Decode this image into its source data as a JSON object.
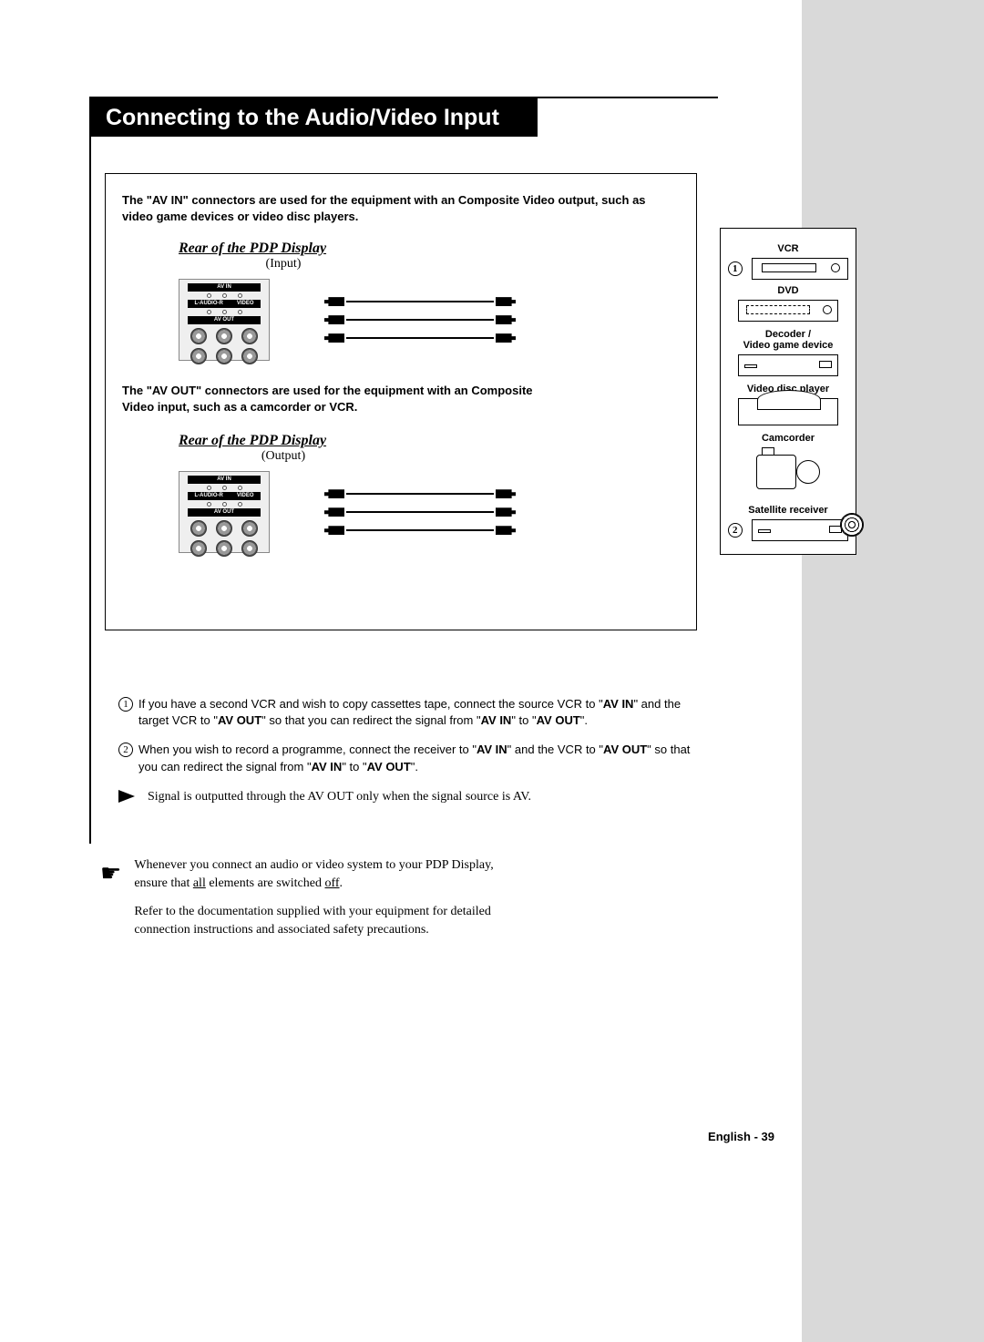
{
  "title": "Connecting to the Audio/Video Input",
  "intro": "The \"AV IN\" connectors are used for the equipment with an Composite Video output, such as video game devices or video disc players.",
  "section1": {
    "heading": "Rear of the PDP Display",
    "sub": "(Input)"
  },
  "mid": "The \"AV OUT\" connectors are used for the equipment with an Composite Video input, such as a camcorder or VCR.",
  "section2": {
    "heading": "Rear of the PDP Display",
    "sub": "(Output)"
  },
  "panel": {
    "av_in": "AV IN",
    "audio_l": "L-AUDIO-R",
    "video": "VIDEO",
    "av_out": "AV OUT"
  },
  "devices": {
    "num1": "1",
    "vcr": "VCR",
    "dvd": "DVD",
    "decoder": "Decoder /",
    "game": "Video game device",
    "disc": "Video disc player",
    "cam": "Camcorder",
    "sat": "Satellite receiver",
    "num2": "2"
  },
  "notes": {
    "n1_num": "1",
    "n1_a": "If you have a second VCR and wish to copy cassettes tape, connect the source VCR to \"",
    "n1_b": "AV IN",
    "n1_c": "\" and the target VCR to \"",
    "n1_d": "AV OUT",
    "n1_e": "\" so that you can redirect the signal from \"",
    "n1_f": "AV IN",
    "n1_g": "\" to \"",
    "n1_h": "AV OUT",
    "n1_i": "\".",
    "n2_num": "2",
    "n2_a": "When you wish to record a programme, connect the receiver to \"",
    "n2_b": "AV IN",
    "n2_c": "\" and the VCR to \"",
    "n2_d": "AV OUT",
    "n2_e": "\" so that you can redirect the signal from \"",
    "n2_f": "AV IN",
    "n2_g": "\" to \"",
    "n2_h": "AV OUT",
    "n2_i": "\".",
    "tri": "Signal is outputted through the AV OUT only when the signal source is AV."
  },
  "tip": {
    "p1a": "Whenever you connect an audio or video system to your PDP Display, ensure that ",
    "p1b": "all",
    "p1c": " elements are switched ",
    "p1d": "off",
    "p1e": ".",
    "p2": "Refer to the documentation supplied with your equipment for detailed connection instructions and associated safety precautions."
  },
  "footer": "English - 39"
}
